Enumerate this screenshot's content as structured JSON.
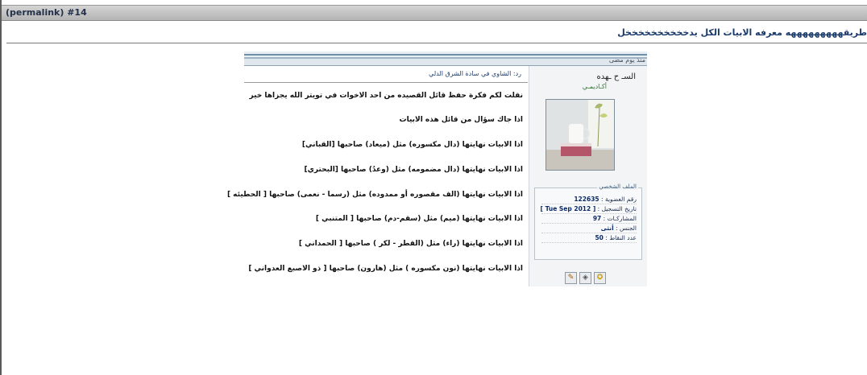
{
  "permalink": {
    "label": "(permalink) #14"
  },
  "thread": {
    "title": "طريقهههههههههه معرفه الابيات الكل يدخخخخخخخخخخل"
  },
  "post": {
    "date": "منذ يوم مضى",
    "author": {
      "name": "السـ ح ـهده",
      "title": "أكـاديمـي"
    },
    "profile": {
      "legend": "الملف الشخصي",
      "rows": [
        {
          "label": "رقم العضوية :",
          "value": "122635"
        },
        {
          "label": "تاريخ التسجيل :",
          "value": "Tue Sep 2012"
        },
        {
          "label": "المشاركـات :",
          "value": "97"
        },
        {
          "label": "الجنس :",
          "value": "أنثى"
        },
        {
          "label": "عدد النقاط :",
          "value": "50"
        }
      ]
    },
    "reply_title": "رد: الشاوي في سادة الشرق الدلي",
    "lines": [
      "نقلت لكم فكرة حفظ قائل القصيده من احد الاخوات في تويتر الله يجزاها خير",
      "اذا جاك سؤال من قائل هذه الابيات",
      "اذا الابيات نهايتها (دال مكسوره) مثل (ميعاد) صاحبها [القباني]",
      "اذا الابيات نهايتها (دال مضمومه) مثل (وعدُ) صاحبها [البحتري]",
      "اذا الابيات نهايتها (الف مقصوره أو ممدوده) مثل (رسما - نعمى) صاحبها [ الحطيئه ]",
      "اذا الابيات نهايتها (ميم) مثل (سقم-دم) صاحبها [ المتنبي ]",
      "اذا الابيات نهايتها (راء) مثل (القطر - لكر ) صاحبها [ الحمداني ]",
      "اذا الابيات نهايتها (نون مكسوره ) مثل (هارون) صاحبها [ ذو الاصبع العدواني ]"
    ]
  },
  "colors": {
    "header": "#b4b4b4",
    "title": "#1a3a6a",
    "profile_text": "#0a2a6a"
  }
}
